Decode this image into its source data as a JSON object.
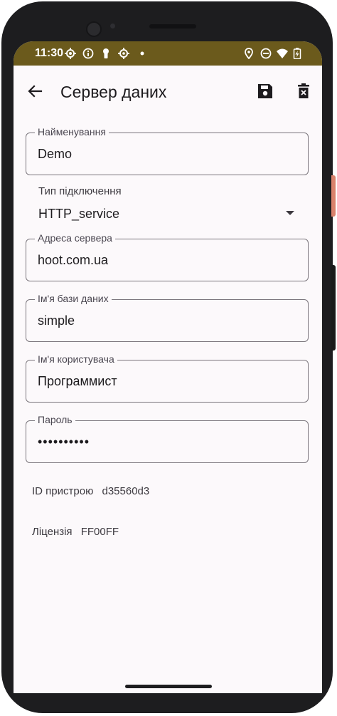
{
  "status_bar": {
    "time": "11:30"
  },
  "app_bar": {
    "title": "Сервер даних"
  },
  "form": {
    "name": {
      "label": "Найменування",
      "value": "Demo"
    },
    "connection_type": {
      "label": "Тип підключення",
      "value": "HTTP_service"
    },
    "server_address": {
      "label": "Адреса сервера",
      "value": "hoot.com.ua"
    },
    "database_name": {
      "label": "Ім'я бази даних",
      "value": "simple"
    },
    "username": {
      "label": "Ім'я користувача",
      "value": "Программист"
    },
    "password": {
      "label": "Пароль",
      "value": "••••••••••"
    }
  },
  "info": {
    "device_id": {
      "label": "ID пристрою",
      "value": "d35560d3"
    },
    "license": {
      "label": "Ліцензія",
      "value": "FF00FF"
    }
  },
  "colors": {
    "status_bar_bg": "#6b5a1c",
    "screen_bg": "#fcf9fb",
    "outline": "#7a757c"
  },
  "icons": [
    "settings-icon",
    "info-icon",
    "keyhole-icon",
    "gear-icon",
    "dot-icon",
    "location-icon",
    "do-not-disturb-icon",
    "wifi-icon",
    "battery-icon",
    "back-arrow-icon",
    "save-icon",
    "delete-icon",
    "dropdown-arrow-icon"
  ]
}
